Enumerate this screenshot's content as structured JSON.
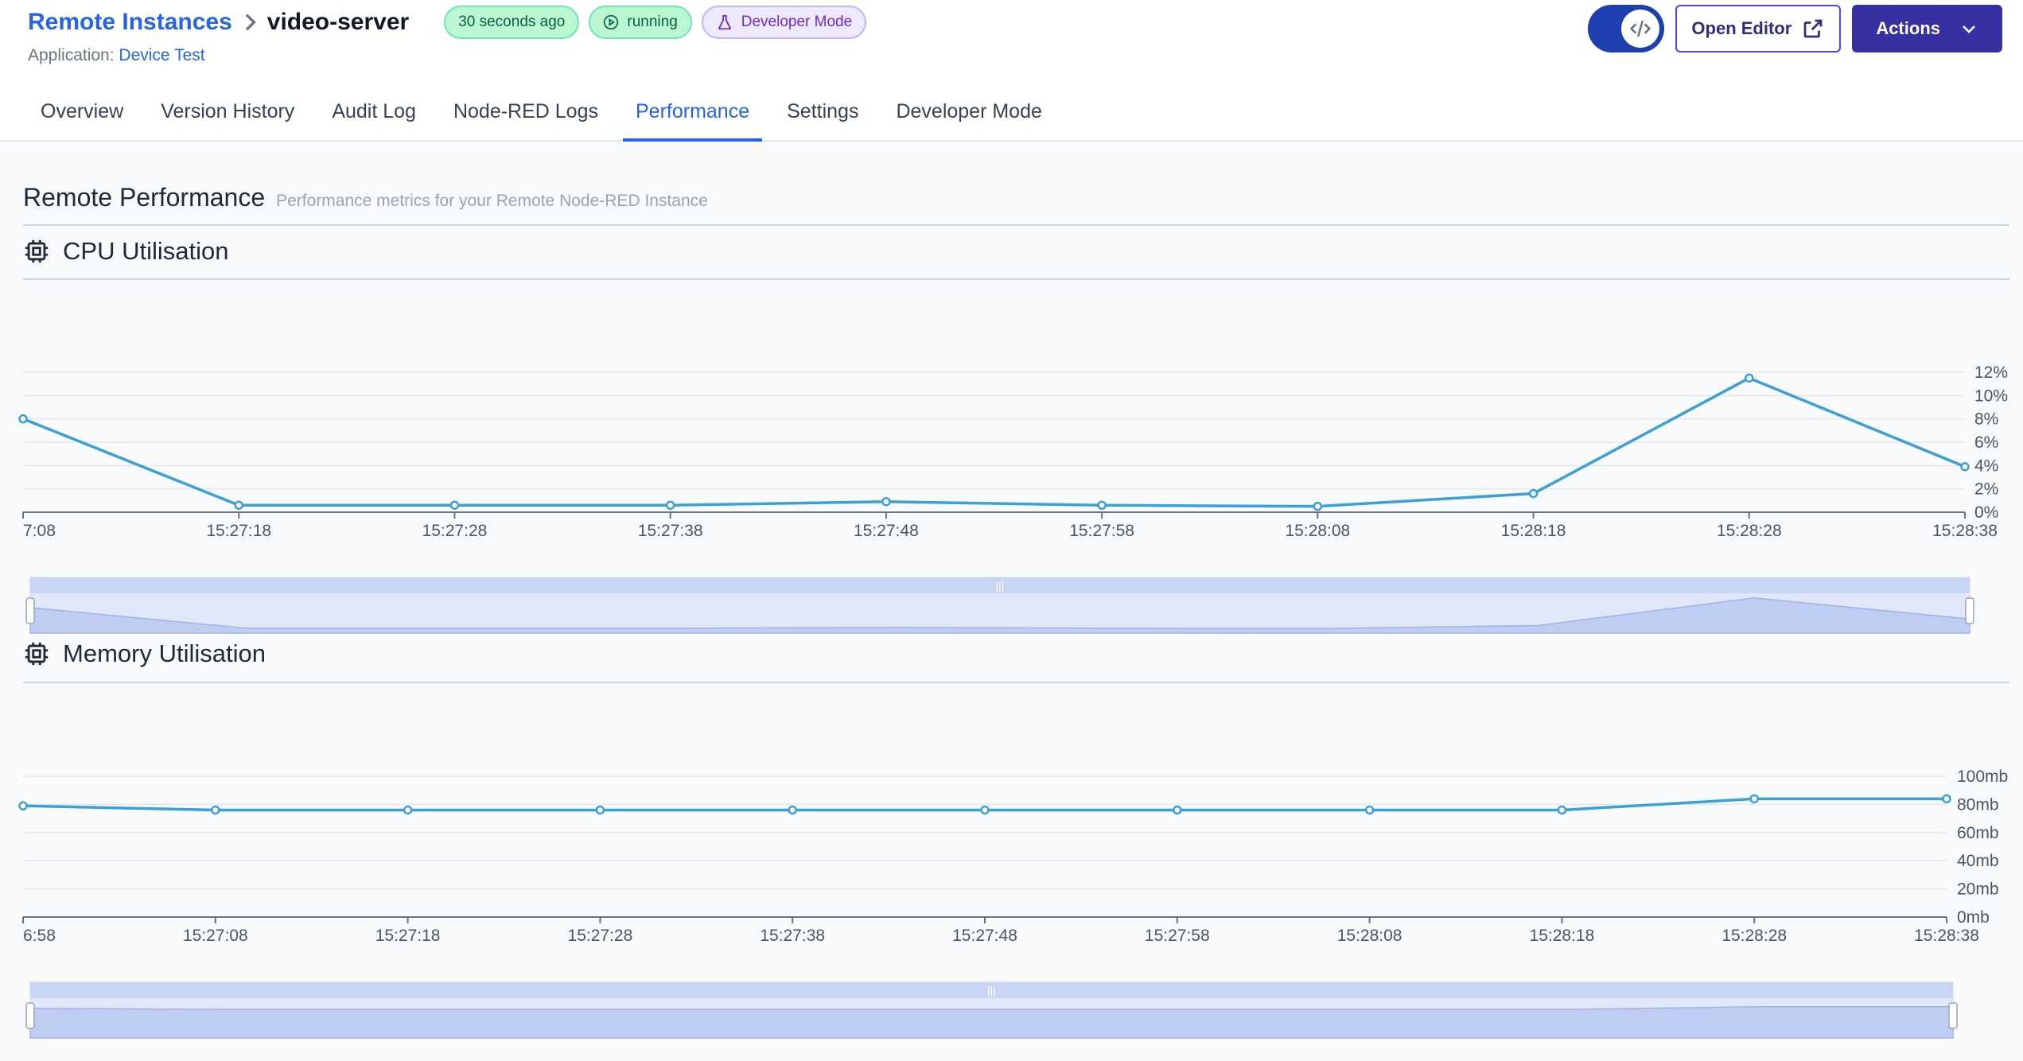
{
  "breadcrumb": {
    "parent": "Remote Instances",
    "current": "video-server"
  },
  "badges": {
    "last_seen": "30 seconds ago",
    "status": "running",
    "mode": "Developer Mode"
  },
  "application": {
    "label": "Application:",
    "name": "Device Test"
  },
  "actions": {
    "open_editor": "Open Editor",
    "actions": "Actions"
  },
  "tabs": [
    {
      "label": "Overview"
    },
    {
      "label": "Version History"
    },
    {
      "label": "Audit Log"
    },
    {
      "label": "Node-RED Logs"
    },
    {
      "label": "Performance"
    },
    {
      "label": "Settings"
    },
    {
      "label": "Developer Mode"
    }
  ],
  "active_tab": "Performance",
  "section": {
    "title": "Remote Performance",
    "subtitle": "Performance metrics for your Remote Node-RED Instance"
  },
  "colors": {
    "accent": "#2563eb",
    "line": "#3b9fd8",
    "primary": "#3730a3"
  },
  "chart_data": [
    {
      "title": "CPU Utilisation",
      "type": "line",
      "x": [
        "7:08",
        "15:27:18",
        "15:27:28",
        "15:27:38",
        "15:27:48",
        "15:27:58",
        "15:28:08",
        "15:28:18",
        "15:28:28",
        "15:28:38"
      ],
      "values": [
        8.0,
        0.6,
        0.6,
        0.6,
        0.9,
        0.6,
        0.5,
        1.6,
        11.5,
        3.9
      ],
      "yticks": [
        "0%",
        "2%",
        "4%",
        "6%",
        "8%",
        "10%",
        "12%"
      ],
      "ylim": [
        0,
        12
      ],
      "grid": true
    },
    {
      "title": "Memory Utilisation",
      "type": "line",
      "x": [
        "6:58",
        "15:27:08",
        "15:27:18",
        "15:27:28",
        "15:27:38",
        "15:27:48",
        "15:27:58",
        "15:28:08",
        "15:28:18",
        "15:28:28",
        "15:28:38"
      ],
      "values": [
        79,
        76,
        76,
        76,
        76,
        76,
        76,
        76,
        76,
        84,
        84
      ],
      "yticks": [
        "0mb",
        "20mb",
        "40mb",
        "60mb",
        "80mb",
        "100mb"
      ],
      "ylim": [
        0,
        100
      ],
      "grid": true
    }
  ]
}
